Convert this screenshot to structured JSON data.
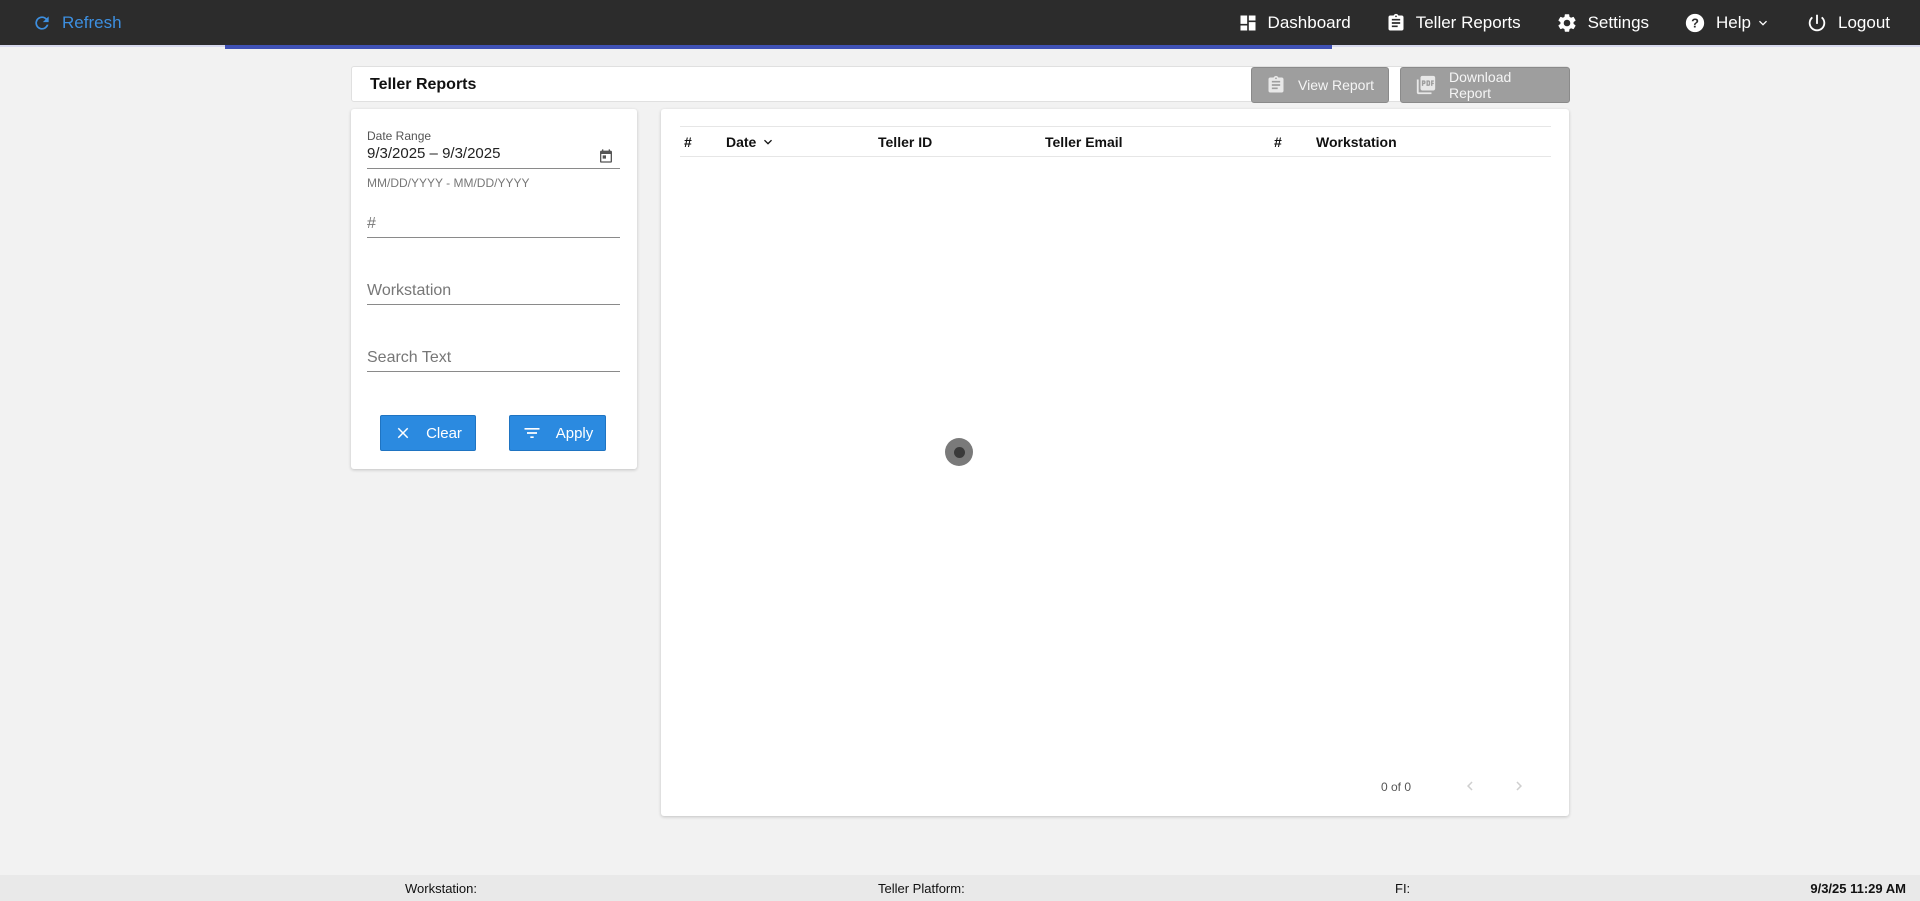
{
  "topbar": {
    "refresh_label": "Refresh",
    "nav": {
      "dashboard": "Dashboard",
      "teller_reports": "Teller Reports",
      "settings": "Settings",
      "help": "Help",
      "logout": "Logout"
    },
    "accent_color": "#3d8fe0",
    "progress_color": "#3f51b5"
  },
  "header": {
    "title": "Teller Reports",
    "view_report": "View Report",
    "download_report": "Download Report"
  },
  "filters": {
    "date_range_label": "Date Range",
    "date_range_value": "9/3/2025 – 9/3/2025",
    "date_format_hint": "MM/DD/YYYY - MM/DD/YYYY",
    "number_placeholder": "#",
    "workstation_placeholder": "Workstation",
    "search_placeholder": "Search Text",
    "clear_label": "Clear",
    "apply_label": "Apply",
    "button_color": "#2b8ae0"
  },
  "table": {
    "columns": [
      "#",
      "Date",
      "Teller ID",
      "Teller Email",
      "#",
      "Workstation"
    ],
    "rows": [],
    "pagination": "0 of 0"
  },
  "footer": {
    "workstation_label": "Workstation:",
    "teller_platform_label": "Teller Platform:",
    "fi_label": "FI:",
    "timestamp": "9/3/25 11:29 AM"
  }
}
